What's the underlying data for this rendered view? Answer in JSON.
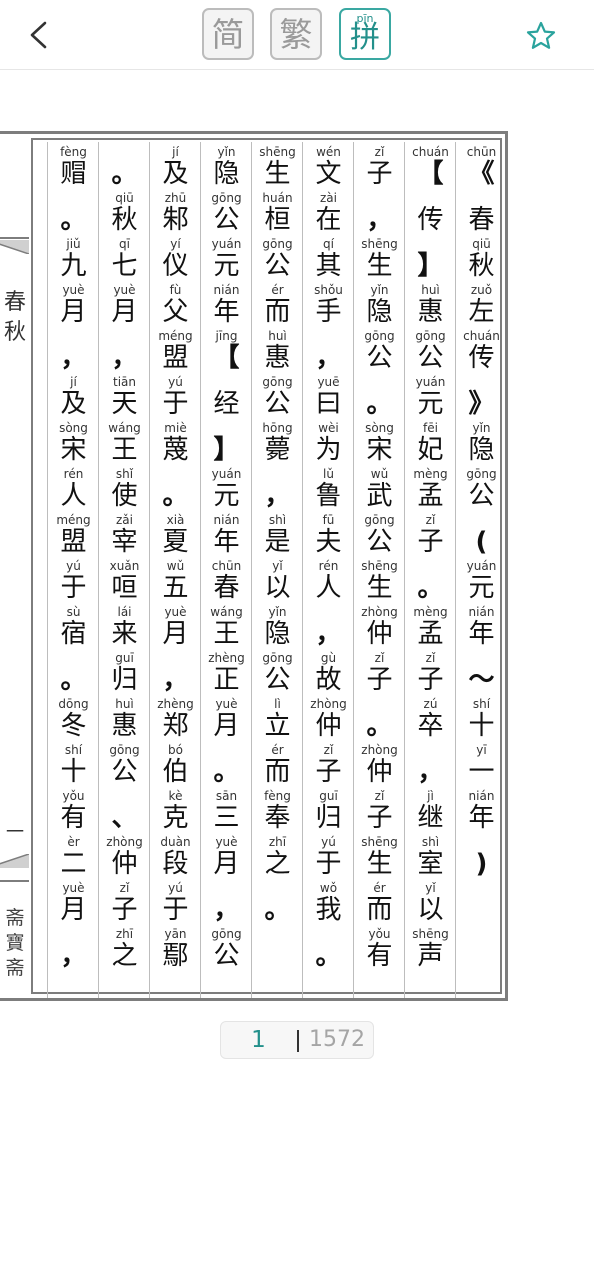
{
  "toolbar": {
    "simplified_label": "简",
    "traditional_label": "繁",
    "pinyin_label": "拼",
    "pinyin_label_pinyin": "pīn",
    "back_icon": "chevron-left-icon",
    "favorite_icon": "star-outline-icon",
    "accent_color": "#23908b"
  },
  "book": {
    "side_title_chars": [
      "春",
      "秋"
    ],
    "side_page_num": "一",
    "side_seal_chars": [
      "斋",
      "寶",
      "斋"
    ],
    "columns": [
      [
        {
          "p": "chūn",
          "c": "《"
        },
        {
          "p": "",
          "c": "春"
        },
        {
          "p": "qiū",
          "c": "秋"
        },
        {
          "p": "zuǒ",
          "c": "左"
        },
        {
          "p": "chuán",
          "c": "传"
        },
        {
          "p": "",
          "c": "》"
        },
        {
          "p": "yǐn",
          "c": "隐"
        },
        {
          "p": "gōng",
          "c": "公"
        },
        {
          "p": "",
          "c": "("
        },
        {
          "p": "yuán",
          "c": "元"
        },
        {
          "p": "nián",
          "c": "年"
        },
        {
          "p": "",
          "c": "～"
        },
        {
          "p": "shí",
          "c": "十"
        },
        {
          "p": "yī",
          "c": "一"
        },
        {
          "p": "nián",
          "c": "年"
        },
        {
          "p": "",
          "c": ")"
        }
      ],
      [
        {
          "p": "chuán",
          "c": "【"
        },
        {
          "p": "",
          "c": "传"
        },
        {
          "p": "",
          "c": "】"
        },
        {
          "p": "huì",
          "c": "惠"
        },
        {
          "p": "gōng",
          "c": "公"
        },
        {
          "p": "yuán",
          "c": "元"
        },
        {
          "p": "fēi",
          "c": "妃"
        },
        {
          "p": "mèng",
          "c": "孟"
        },
        {
          "p": "zǐ",
          "c": "子"
        },
        {
          "p": "",
          "c": "。"
        },
        {
          "p": "mèng",
          "c": "孟"
        },
        {
          "p": "zǐ",
          "c": "子"
        },
        {
          "p": "zú",
          "c": "卒"
        },
        {
          "p": "",
          "c": "，"
        },
        {
          "p": "jì",
          "c": "继"
        },
        {
          "p": "shì",
          "c": "室"
        },
        {
          "p": "yǐ",
          "c": "以"
        },
        {
          "p": "shēng",
          "c": "声"
        }
      ],
      [
        {
          "p": "zǐ",
          "c": "子"
        },
        {
          "p": "",
          "c": "，"
        },
        {
          "p": "shēng",
          "c": "生"
        },
        {
          "p": "yǐn",
          "c": "隐"
        },
        {
          "p": "gōng",
          "c": "公"
        },
        {
          "p": "",
          "c": "。"
        },
        {
          "p": "sòng",
          "c": "宋"
        },
        {
          "p": "wǔ",
          "c": "武"
        },
        {
          "p": "gōng",
          "c": "公"
        },
        {
          "p": "shēng",
          "c": "生"
        },
        {
          "p": "zhòng",
          "c": "仲"
        },
        {
          "p": "zǐ",
          "c": "子"
        },
        {
          "p": "",
          "c": "。"
        },
        {
          "p": "zhòng",
          "c": "仲"
        },
        {
          "p": "zǐ",
          "c": "子"
        },
        {
          "p": "shēng",
          "c": "生"
        },
        {
          "p": "ér",
          "c": "而"
        },
        {
          "p": "yǒu",
          "c": "有"
        }
      ],
      [
        {
          "p": "wén",
          "c": "文"
        },
        {
          "p": "zài",
          "c": "在"
        },
        {
          "p": "qí",
          "c": "其"
        },
        {
          "p": "shǒu",
          "c": "手"
        },
        {
          "p": "",
          "c": "，"
        },
        {
          "p": "yuē",
          "c": "曰"
        },
        {
          "p": "wèi",
          "c": "为"
        },
        {
          "p": "lǔ",
          "c": "鲁"
        },
        {
          "p": "fū",
          "c": "夫"
        },
        {
          "p": "rén",
          "c": "人"
        },
        {
          "p": "",
          "c": "，"
        },
        {
          "p": "gù",
          "c": "故"
        },
        {
          "p": "zhòng",
          "c": "仲"
        },
        {
          "p": "zǐ",
          "c": "子"
        },
        {
          "p": "guī",
          "c": "归"
        },
        {
          "p": "yú",
          "c": "于"
        },
        {
          "p": "wǒ",
          "c": "我"
        },
        {
          "p": "",
          "c": "。"
        }
      ],
      [
        {
          "p": "shēng",
          "c": "生"
        },
        {
          "p": "huán",
          "c": "桓"
        },
        {
          "p": "gōng",
          "c": "公"
        },
        {
          "p": "ér",
          "c": "而"
        },
        {
          "p": "huì",
          "c": "惠"
        },
        {
          "p": "gōng",
          "c": "公"
        },
        {
          "p": "hōng",
          "c": "薨"
        },
        {
          "p": "",
          "c": "，"
        },
        {
          "p": "shì",
          "c": "是"
        },
        {
          "p": "yǐ",
          "c": "以"
        },
        {
          "p": "yǐn",
          "c": "隐"
        },
        {
          "p": "gōng",
          "c": "公"
        },
        {
          "p": "lì",
          "c": "立"
        },
        {
          "p": "ér",
          "c": "而"
        },
        {
          "p": "fèng",
          "c": "奉"
        },
        {
          "p": "zhī",
          "c": "之"
        },
        {
          "p": "",
          "c": "。"
        }
      ],
      [
        {
          "p": "yǐn",
          "c": "隐"
        },
        {
          "p": "gōng",
          "c": "公"
        },
        {
          "p": "yuán",
          "c": "元"
        },
        {
          "p": "nián",
          "c": "年"
        },
        {
          "p": "jīng",
          "c": "【"
        },
        {
          "p": "",
          "c": "经"
        },
        {
          "p": "",
          "c": "】"
        },
        {
          "p": "yuán",
          "c": "元"
        },
        {
          "p": "nián",
          "c": "年"
        },
        {
          "p": "chūn",
          "c": "春"
        },
        {
          "p": "wáng",
          "c": "王"
        },
        {
          "p": "zhèng",
          "c": "正"
        },
        {
          "p": "yuè",
          "c": "月"
        },
        {
          "p": "",
          "c": "。"
        },
        {
          "p": "sān",
          "c": "三"
        },
        {
          "p": "yuè",
          "c": "月"
        },
        {
          "p": "",
          "c": "，"
        },
        {
          "p": "gōng",
          "c": "公"
        }
      ],
      [
        {
          "p": "jí",
          "c": "及"
        },
        {
          "p": "zhū",
          "c": "邾"
        },
        {
          "p": "yí",
          "c": "仪"
        },
        {
          "p": "fù",
          "c": "父"
        },
        {
          "p": "méng",
          "c": "盟"
        },
        {
          "p": "yú",
          "c": "于"
        },
        {
          "p": "miè",
          "c": "蔑"
        },
        {
          "p": "",
          "c": "。"
        },
        {
          "p": "xià",
          "c": "夏"
        },
        {
          "p": "wǔ",
          "c": "五"
        },
        {
          "p": "yuè",
          "c": "月"
        },
        {
          "p": "",
          "c": "，"
        },
        {
          "p": "zhèng",
          "c": "郑"
        },
        {
          "p": "bó",
          "c": "伯"
        },
        {
          "p": "kè",
          "c": "克"
        },
        {
          "p": "duàn",
          "c": "段"
        },
        {
          "p": "yú",
          "c": "于"
        },
        {
          "p": "yān",
          "c": "鄢"
        }
      ],
      [
        {
          "p": "",
          "c": "。"
        },
        {
          "p": "qiū",
          "c": "秋"
        },
        {
          "p": "qī",
          "c": "七"
        },
        {
          "p": "yuè",
          "c": "月"
        },
        {
          "p": "",
          "c": "，"
        },
        {
          "p": "tiān",
          "c": "天"
        },
        {
          "p": "wáng",
          "c": "王"
        },
        {
          "p": "shǐ",
          "c": "使"
        },
        {
          "p": "zǎi",
          "c": "宰"
        },
        {
          "p": "xuǎn",
          "c": "咺"
        },
        {
          "p": "lái",
          "c": "来"
        },
        {
          "p": "guī",
          "c": "归"
        },
        {
          "p": "huì",
          "c": "惠"
        },
        {
          "p": "gōng",
          "c": "公"
        },
        {
          "p": "",
          "c": "、"
        },
        {
          "p": "zhòng",
          "c": "仲"
        },
        {
          "p": "zǐ",
          "c": "子"
        },
        {
          "p": "zhī",
          "c": "之"
        }
      ],
      [
        {
          "p": "fèng",
          "c": "赗"
        },
        {
          "p": "",
          "c": "。"
        },
        {
          "p": "jiǔ",
          "c": "九"
        },
        {
          "p": "yuè",
          "c": "月"
        },
        {
          "p": "",
          "c": "，"
        },
        {
          "p": "jí",
          "c": "及"
        },
        {
          "p": "sòng",
          "c": "宋"
        },
        {
          "p": "rén",
          "c": "人"
        },
        {
          "p": "méng",
          "c": "盟"
        },
        {
          "p": "yú",
          "c": "于"
        },
        {
          "p": "sù",
          "c": "宿"
        },
        {
          "p": "",
          "c": "。"
        },
        {
          "p": "dōng",
          "c": "冬"
        },
        {
          "p": "shí",
          "c": "十"
        },
        {
          "p": "yǒu",
          "c": "有"
        },
        {
          "p": "èr",
          "c": "二"
        },
        {
          "p": "yuè",
          "c": "月"
        },
        {
          "p": "",
          "c": "，"
        }
      ]
    ]
  },
  "pager": {
    "current": "1",
    "total": "1572"
  }
}
